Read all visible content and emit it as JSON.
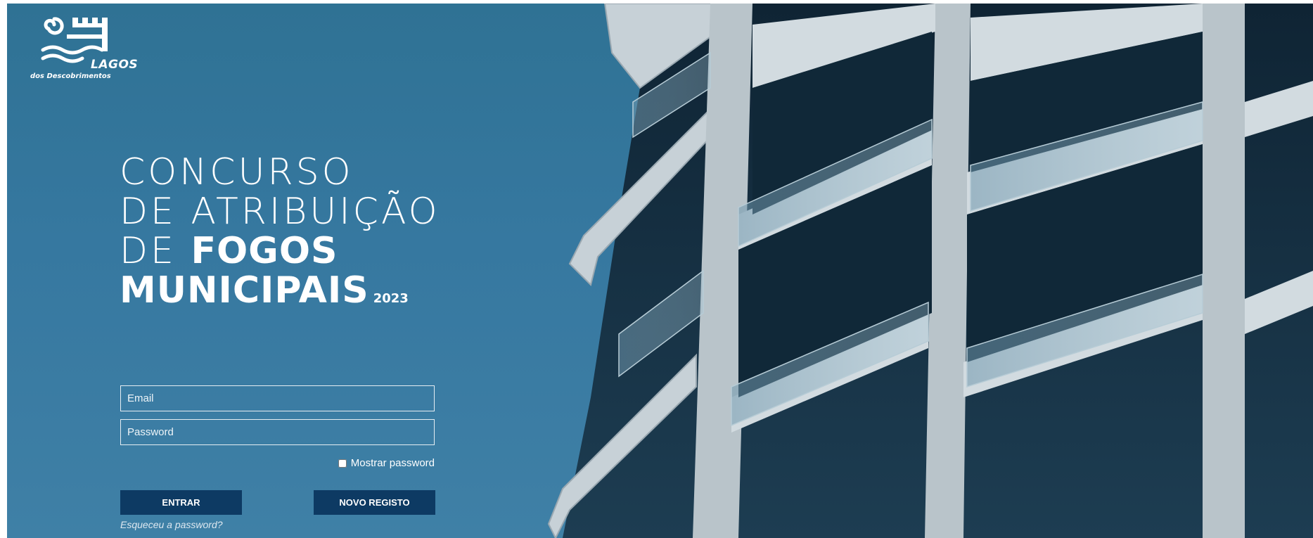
{
  "logo": {
    "name": "LAGOS",
    "subtitle": "dos Descobrimentos"
  },
  "hero": {
    "line1": "CONCURSO",
    "line2": "DE ATRIBUIÇÃO",
    "line3_prefix": "DE ",
    "line3_bold": "FOGOS",
    "line4_bold": "MUNICIPAIS",
    "year": "2023"
  },
  "form": {
    "email_placeholder": "Email",
    "password_placeholder": "Password",
    "show_password_label": "Mostrar password",
    "login_button": "ENTRAR",
    "register_button": "NOVO REGISTO",
    "forgot_link": "Esqueceu a password?"
  },
  "colors": {
    "background": "#3678a0",
    "button": "#0d3a63",
    "building": "#c9d3d9"
  }
}
